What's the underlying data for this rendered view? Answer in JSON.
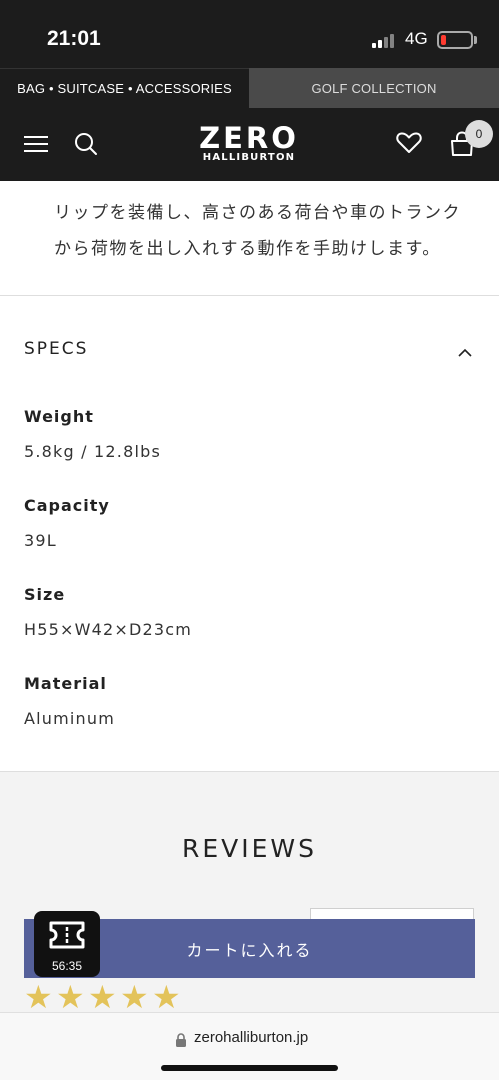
{
  "status_bar": {
    "time": "21:01",
    "network": "4G",
    "battery_color": "#ff3b30"
  },
  "top_tabs": {
    "left": "BAG • SUITCASE • ACCESSORIES",
    "right": "GOLF COLLECTION"
  },
  "header": {
    "logo_main": "ZERO",
    "logo_sub": "HALLIBURTON",
    "cart_count": "0",
    "icons": [
      "menu-icon",
      "search-icon",
      "heart-icon",
      "shopping-bag-icon"
    ]
  },
  "description": {
    "line1": "リップを装備し、高さのある荷台や車のトランク",
    "line2": "から荷物を出し入れする動作を手助けします。"
  },
  "specs": {
    "title": "SPECS",
    "items": [
      {
        "label": "Weight",
        "value": "5.8kg / 12.8lbs"
      },
      {
        "label": "Capacity",
        "value": "39L"
      },
      {
        "label": "Size",
        "value": "H55×W42×D23cm"
      },
      {
        "label": "Material",
        "value": "Aluminum"
      }
    ]
  },
  "reviews": {
    "title": "REVIEWS",
    "rating": 5,
    "star_color": "#e3c35a"
  },
  "cart_button": {
    "label": "カートに入れる",
    "color": "#55609a"
  },
  "timer": {
    "text": "56:35"
  },
  "browser": {
    "url": "zerohalliburton.jp"
  }
}
